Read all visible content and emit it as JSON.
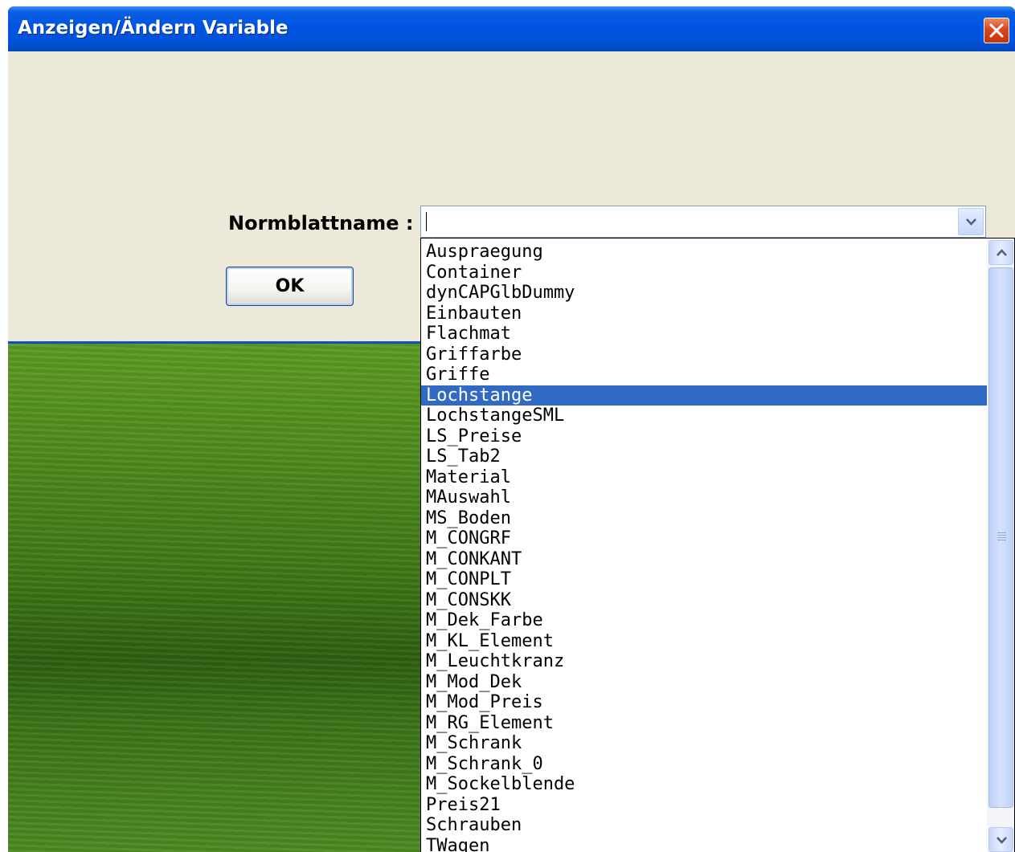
{
  "window": {
    "title": "Anzeigen/Ändern Variable"
  },
  "form": {
    "label": "Normblattname :",
    "ok_label": "OK",
    "combo_value": ""
  },
  "dropdown": {
    "selected_index": 7,
    "items": [
      "Auspraegung",
      "Container",
      "dynCAPGlbDummy",
      "Einbauten",
      "Flachmat",
      "Griffarbe",
      "Griffe",
      "Lochstange",
      "LochstangeSML",
      "LS_Preise",
      "LS_Tab2",
      "Material",
      "MAuswahl",
      "MS_Boden",
      "M_CONGRF",
      "M_CONKANT",
      "M_CONPLT",
      "M_CONSKK",
      "M_Dek_Farbe",
      "M_KL_Element",
      "M_Leuchtkranz",
      "M_Mod_Dek",
      "M_Mod_Preis",
      "M_RG_Element",
      "M_Schrank",
      "M_Schrank_0",
      "M_Sockelblende",
      "Preis21",
      "Schrauben",
      "TWagen"
    ]
  },
  "icons": {
    "close": "close-icon",
    "combo_arrow": "chevron-down-icon",
    "scroll_up": "chevron-up-icon",
    "scroll_down": "chevron-down-icon"
  },
  "colors": {
    "titlebar": "#0054e3",
    "selection": "#316ac5",
    "dialog_bg": "#ece9d8"
  }
}
